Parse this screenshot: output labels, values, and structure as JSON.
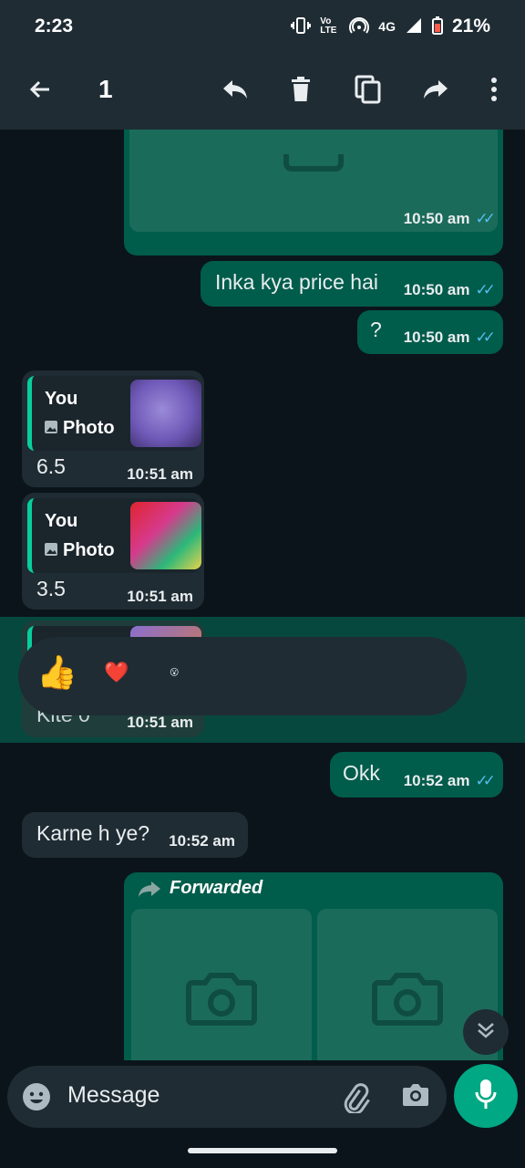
{
  "status_bar": {
    "time": "2:23",
    "network": "4G",
    "volte": "Vo LTE",
    "battery": "21%"
  },
  "app_bar": {
    "selected_count": "1"
  },
  "messages": [
    {
      "type": "outgoing-media",
      "time": "10:50 am"
    },
    {
      "type": "outgoing",
      "text": "Inka kya price hai",
      "time": "10:50 am"
    },
    {
      "type": "outgoing",
      "text": "?",
      "time": "10:50 am"
    },
    {
      "type": "incoming-reply",
      "quote_author": "You",
      "quote_type": "Photo",
      "text": "6.5",
      "time": "10:51 am"
    },
    {
      "type": "incoming-reply",
      "quote_author": "You",
      "quote_type": "Photo",
      "text": "3.5",
      "time": "10:51 am"
    },
    {
      "type": "incoming-reply-selected",
      "text": "Kite 0",
      "time": "10:51 am"
    },
    {
      "type": "outgoing",
      "text": "Okk",
      "time": "10:52 am"
    },
    {
      "type": "incoming",
      "text": "Karne h ye?",
      "time": "10:52 am"
    },
    {
      "type": "outgoing-forwarded",
      "label": "Forwarded"
    }
  ],
  "reactions": [
    "👍",
    "❤️",
    "😮"
  ],
  "composer": {
    "placeholder": "Message"
  },
  "colors": {
    "outgoing_bubble": "#005c4b",
    "incoming_bubble": "#1f2c34",
    "accent": "#00a884",
    "read_ticks": "#53bdeb"
  }
}
